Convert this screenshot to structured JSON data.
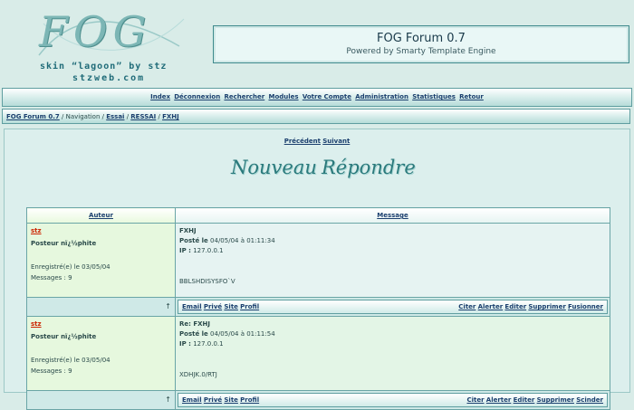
{
  "logo": {
    "letters": "FOG",
    "line1": "skin “lagoon” by stz",
    "line2": "stzweb.com"
  },
  "header": {
    "title": "FOG Forum 0.7",
    "subtitle": "Powered by Smarty Template Engine"
  },
  "nav": [
    "Index",
    "Déconnexion",
    "Rechercher",
    "Modules",
    "Votre Compte",
    "Administration",
    "Statistiques",
    "Retour"
  ],
  "breadcrumb": {
    "forum": "FOG Forum 0.7",
    "navigation": "Navigation",
    "items": [
      "Essai",
      "RESSAI",
      "FXHJ"
    ]
  },
  "pager": {
    "prev": "Précédent",
    "next": "Suivant"
  },
  "actions": {
    "new": "Nouveau",
    "reply": "Répondre"
  },
  "table": {
    "col_author": "Auteur",
    "col_message": "Message"
  },
  "posts": [
    {
      "author": "stz",
      "rank": "Posteur nï¿½phite",
      "registered": "Enregistré(e) le 03/05/04",
      "messages": "Messages : 9",
      "title": "FXHJ",
      "posted_label": "Posté le",
      "posted": "04/05/04 à 01:11:34",
      "ip_label": "IP :",
      "ip": "127.0.0.1",
      "body": "BBLSHDISYSFO`V",
      "arrow": "↑",
      "left_links": [
        "Email",
        "Privé",
        "Site",
        "Profil"
      ],
      "right_links": [
        "Citer",
        "Alerter",
        "Editer",
        "Supprimer",
        "Fusionner"
      ]
    },
    {
      "author": "stz",
      "rank": "Posteur nï¿½phite",
      "registered": "Enregistré(e) le 03/05/04",
      "messages": "Messages : 9",
      "title": "Re: FXHJ",
      "posted_label": "Posté le",
      "posted": "04/05/04 à 01:11:54",
      "ip_label": "IP :",
      "ip": "127.0.0.1",
      "body": "XDHJK.0/RTJ",
      "arrow": "↑",
      "left_links": [
        "Email",
        "Privé",
        "Site",
        "Profil"
      ],
      "right_links": [
        "Citer",
        "Alerter",
        "Editer",
        "Supprimer",
        "Scinder"
      ]
    }
  ]
}
